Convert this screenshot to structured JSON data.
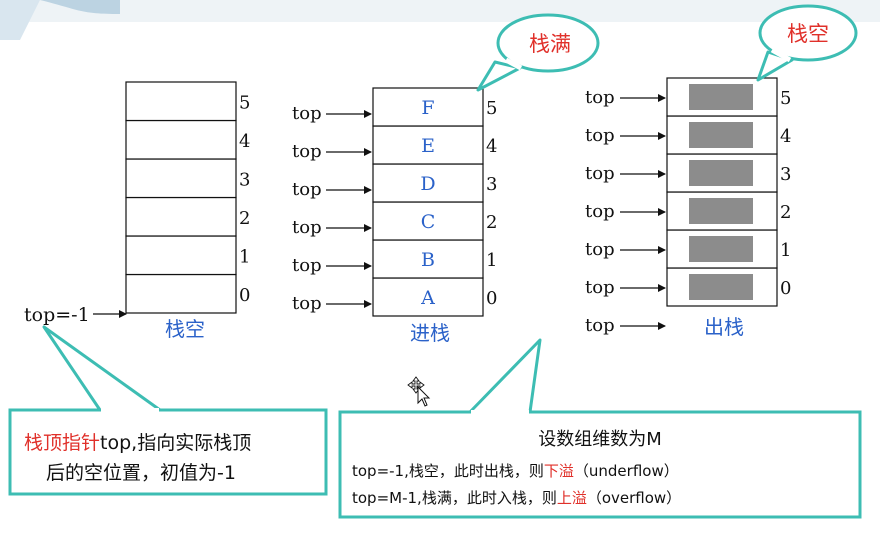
{
  "colors": {
    "teal": "#3dbdb3",
    "blue": "#2b62c9",
    "red": "#e0302a",
    "gray": "#8c8c8c",
    "black": "#111111"
  },
  "stack_indices": [
    "0",
    "1",
    "2",
    "3",
    "4",
    "5"
  ],
  "pointer_label": "top",
  "empty_stack": {
    "pointer_text": "top=-1",
    "caption": "栈空"
  },
  "push_stack": {
    "items": [
      "A",
      "B",
      "C",
      "D",
      "E",
      "F"
    ],
    "caption": "进栈",
    "callout": "栈满"
  },
  "pop_stack": {
    "caption": "出栈",
    "callout": "栈空"
  },
  "note_left": {
    "red_text": "栈顶指针",
    "line1_rest": "top,指向实际栈顶",
    "line2": "后的空位置，初值为-1"
  },
  "note_right": {
    "title": "设数组维数为M",
    "line1_pre": "top=-1,栈空，此时出栈，则",
    "line1_red": "下溢",
    "line1_post": "（underflow）",
    "line2_pre": "top=M-1,栈满，此时入栈，则",
    "line2_red": "上溢",
    "line2_post": "（overflow）"
  }
}
